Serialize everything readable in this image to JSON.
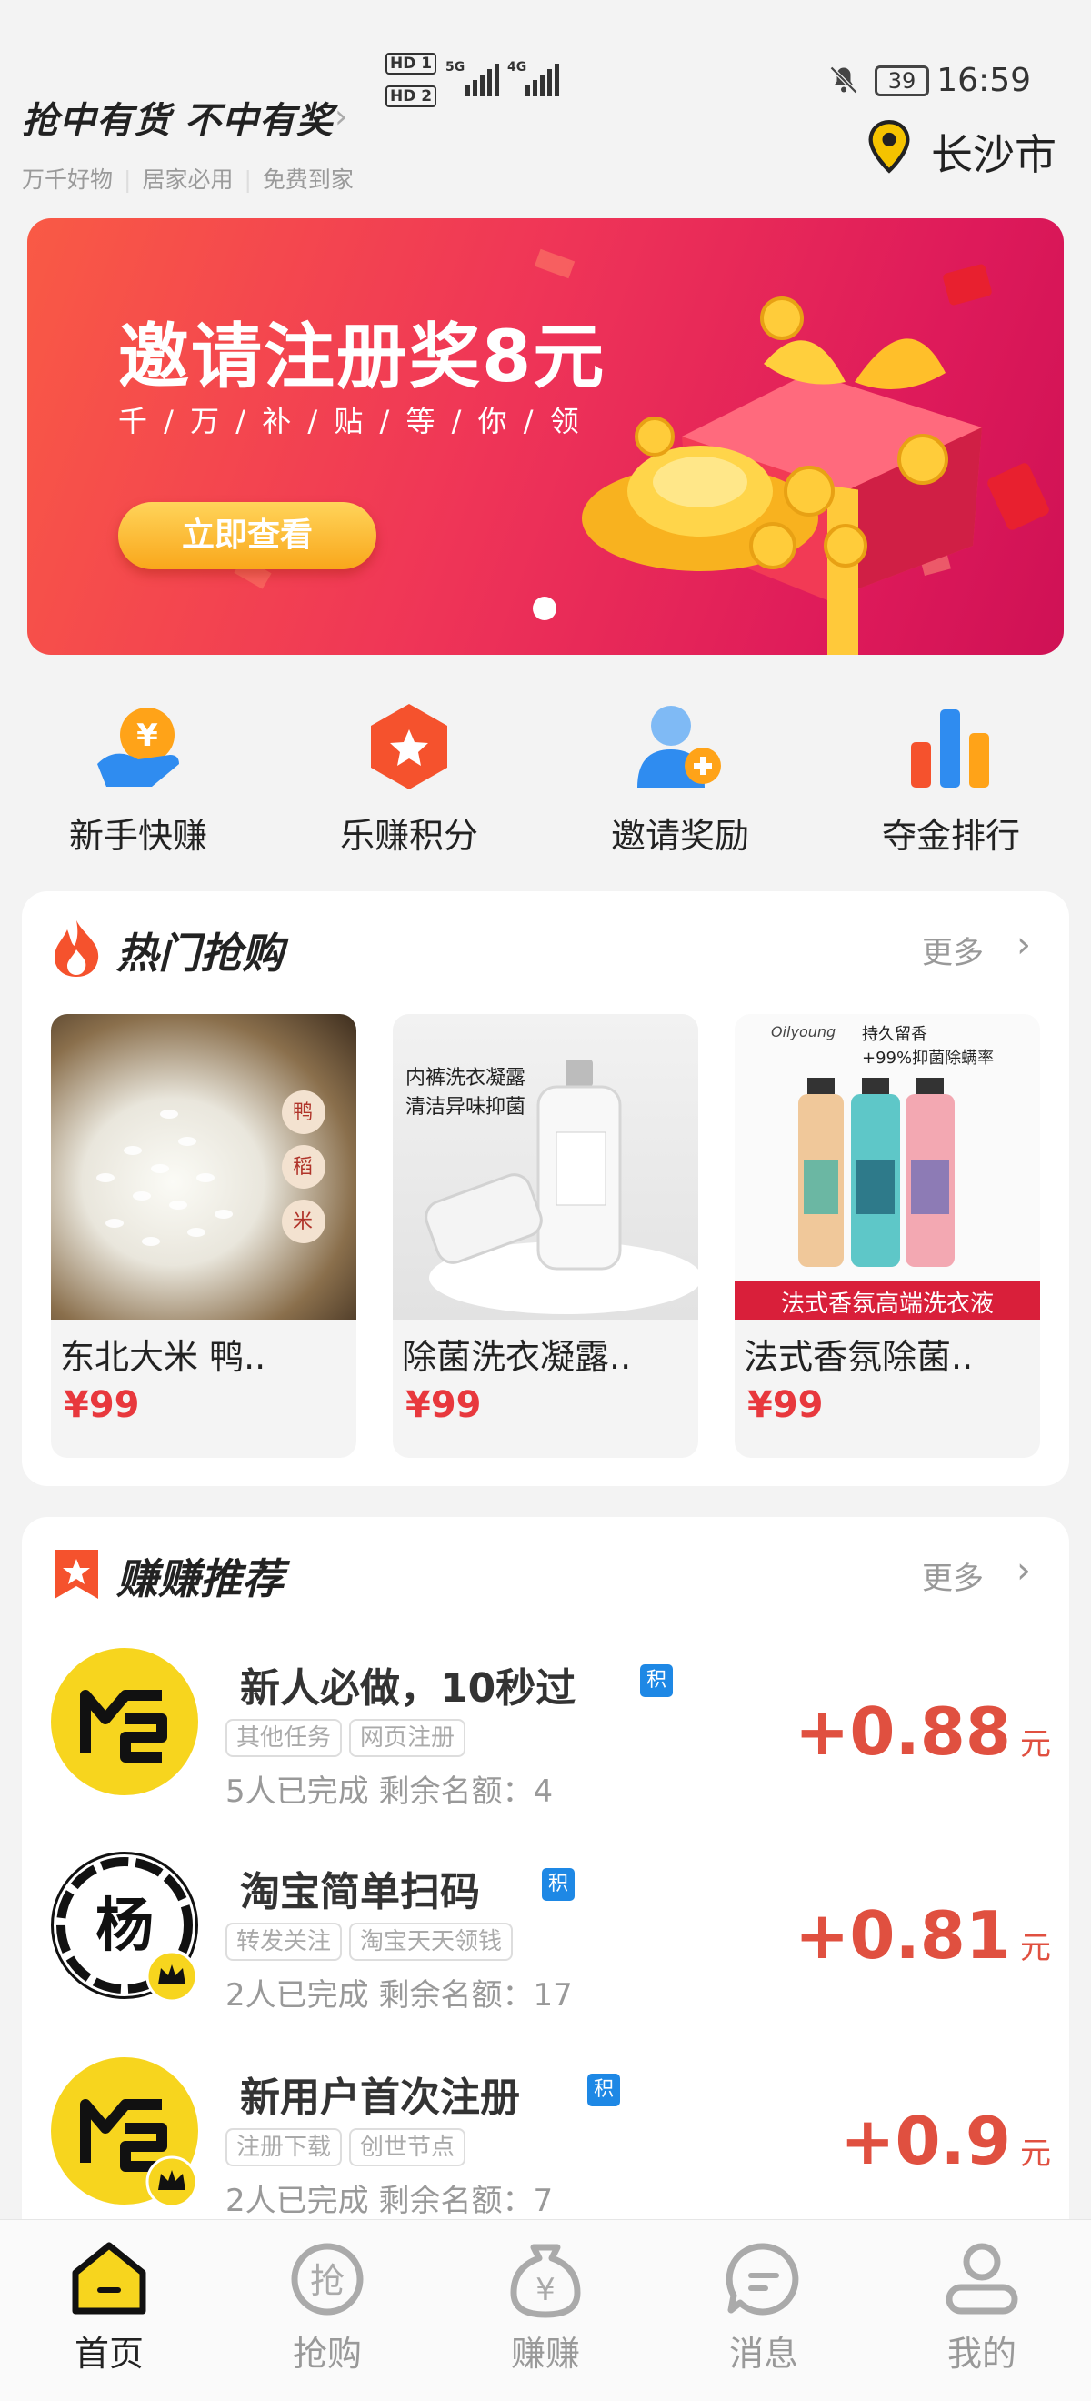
{
  "status_bar": {
    "hd1": "HD 1",
    "hd2": "HD 2",
    "net1": "5G",
    "net2": "4G",
    "battery": "39",
    "time": "16:59"
  },
  "header": {
    "slogan": "抢中有货  不中有奖",
    "subtags": [
      "万千好物",
      "居家必用",
      "免费到家"
    ],
    "city": "长沙市"
  },
  "banner": {
    "title": "邀请注册奖8元",
    "subtitle": "千 / 万 / 补 / 贴 / 等 / 你 / 领",
    "button": "立即查看"
  },
  "quick_nav": [
    {
      "label": "新手快赚",
      "icon": "coin-hand-icon"
    },
    {
      "label": "乐赚积分",
      "icon": "star-hexagon-icon"
    },
    {
      "label": "邀请奖励",
      "icon": "add-user-icon"
    },
    {
      "label": "夺金排行",
      "icon": "bar-chart-icon"
    }
  ],
  "hot_section": {
    "title": "热门抢购",
    "more": "更多",
    "products": [
      {
        "name": "东北大米 鸭..",
        "price": "¥99",
        "img_text": [
          "鸭",
          "稻",
          "米"
        ]
      },
      {
        "name": "除菌洗衣凝露..",
        "price": "¥99",
        "img_text": [
          "内裤洗衣凝露",
          "清洁异味抑菌"
        ]
      },
      {
        "name": "法式香氛除菌..",
        "price": "¥99",
        "img_text": [
          "Oilyoung",
          "持久留香",
          "+99%抑菌除螨率",
          "法式香氛高端洗衣液"
        ]
      }
    ]
  },
  "recommend_section": {
    "title": "赚赚推荐",
    "more": "更多",
    "tasks": [
      {
        "title": "新人必做，10秒过",
        "badge": "积",
        "tags": [
          "其他任务",
          "网页注册"
        ],
        "stats": "5人已完成  剩余名额：4",
        "reward": "+0.88",
        "unit": "元"
      },
      {
        "title": "淘宝简单扫码",
        "badge": "积",
        "tags": [
          "转发关注",
          "淘宝天天领钱"
        ],
        "stats": "2人已完成  剩余名额：17",
        "reward": "+0.81",
        "unit": "元"
      },
      {
        "title": "新用户首次注册",
        "badge": "积",
        "tags": [
          "注册下载",
          "创世节点"
        ],
        "stats": "2人已完成  剩余名额：7",
        "reward": "+0.9",
        "unit": "元"
      }
    ]
  },
  "tab_bar": [
    {
      "label": "首页",
      "active": true
    },
    {
      "label": "抢购",
      "glyph": "抢"
    },
    {
      "label": "赚赚",
      "glyph": "¥"
    },
    {
      "label": "消息"
    },
    {
      "label": "我的"
    }
  ]
}
